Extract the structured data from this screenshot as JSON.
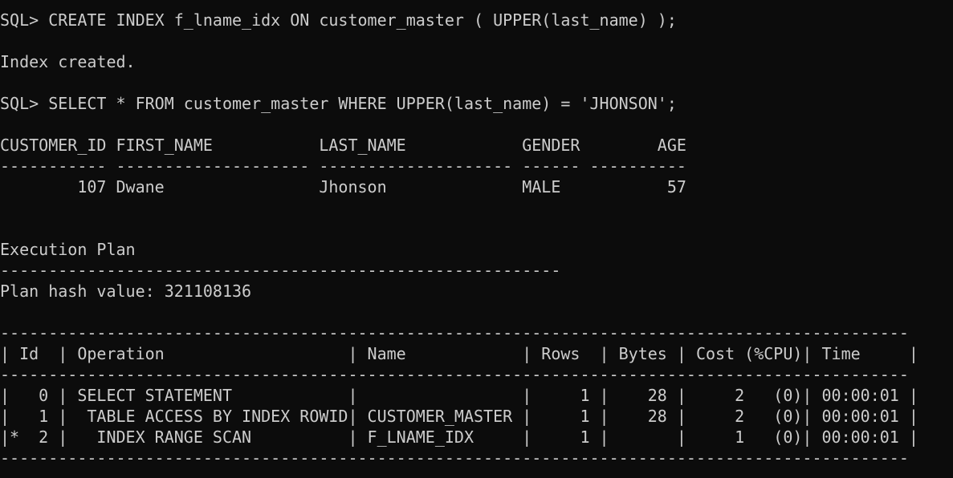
{
  "terminal": {
    "colors": {
      "background": "#0c0c0c",
      "foreground": "#cccccc"
    },
    "lines": [
      "SQL> CREATE INDEX f_lname_idx ON customer_master ( UPPER(last_name) );",
      "",
      "Index created.",
      "",
      "SQL> SELECT * FROM customer_master WHERE UPPER(last_name) = 'JHONSON';",
      "",
      "CUSTOMER_ID FIRST_NAME           LAST_NAME            GENDER        AGE",
      "----------- -------------------- -------------------- ------ ----------",
      "        107 Dwane                Jhonson              MALE           57",
      "",
      "",
      "Execution Plan",
      "----------------------------------------------------------",
      "Plan hash value: 321108136",
      "",
      "----------------------------------------------------------------------------------------------",
      "| Id  | Operation                   | Name            | Rows  | Bytes | Cost (%CPU)| Time     |",
      "----------------------------------------------------------------------------------------------",
      "|   0 | SELECT STATEMENT            |                 |     1 |    28 |     2   (0)| 00:00:01 |",
      "|   1 |  TABLE ACCESS BY INDEX ROWID| CUSTOMER_MASTER |     1 |    28 |     2   (0)| 00:00:01 |",
      "|*  2 |   INDEX RANGE SCAN          | F_LNAME_IDX     |     1 |       |     1   (0)| 00:00:01 |",
      "----------------------------------------------------------------------------------------------"
    ]
  }
}
